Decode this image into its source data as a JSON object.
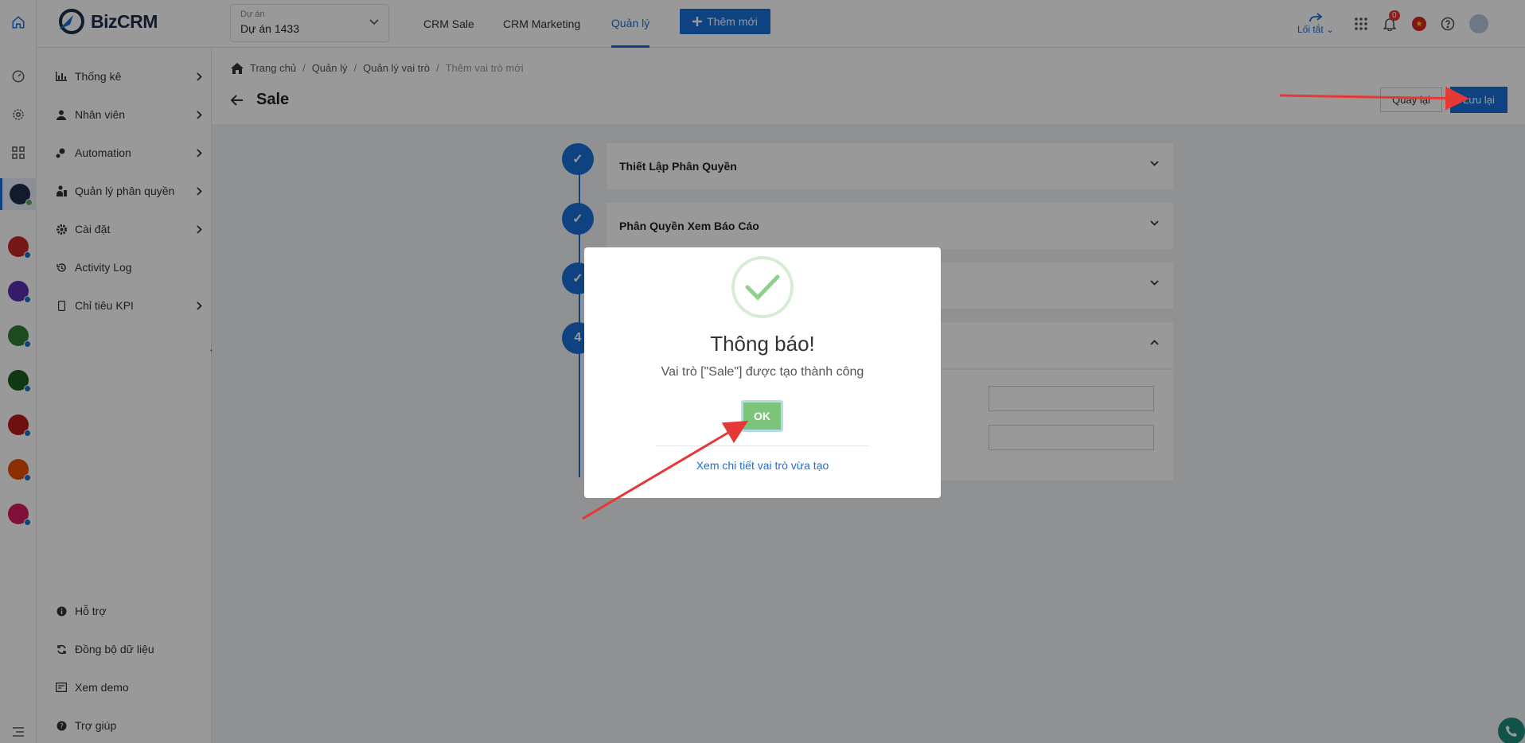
{
  "header": {
    "logo_text": "BizCRM",
    "project_label": "Dự án",
    "project_value": "Dự án 1433",
    "nav": [
      "CRM Sale",
      "CRM Marketing",
      "Quản lý"
    ],
    "add_button": "Thêm mới",
    "shortcut_label": "Lối tắt",
    "notification_count": "0"
  },
  "sidebar": {
    "items": [
      {
        "label": "Thống kê",
        "icon": "bar-chart-icon"
      },
      {
        "label": "Nhân viên",
        "icon": "user-icon"
      },
      {
        "label": "Automation",
        "icon": "automation-icon"
      },
      {
        "label": "Quản lý phân quyền",
        "icon": "permission-icon"
      },
      {
        "label": "Cài đặt",
        "icon": "gear-icon"
      },
      {
        "label": "Activity Log",
        "icon": "history-icon"
      },
      {
        "label": "Chỉ tiêu KPI",
        "icon": "mobile-icon"
      }
    ],
    "bottom": [
      {
        "label": "Hỗ trợ",
        "icon": "info-icon"
      },
      {
        "label": "Đồng bộ dữ liệu",
        "icon": "sync-icon"
      },
      {
        "label": "Xem demo",
        "icon": "demo-icon"
      },
      {
        "label": "Trợ giúp",
        "icon": "help-icon"
      }
    ]
  },
  "breadcrumb": [
    "Trang chủ",
    "Quản lý",
    "Quản lý vai trò",
    "Thêm vai trò mới"
  ],
  "page": {
    "title": "Sale",
    "back_button": "Quay lại",
    "save_button": "Lưu lại"
  },
  "steps": [
    {
      "marker": "✓",
      "title": "Thiết Lập Phân Quyền"
    },
    {
      "marker": "✓",
      "title": "Phân Quyền Xem Báo Cáo"
    },
    {
      "marker": "✓",
      "title": ""
    },
    {
      "marker": "4",
      "title": ""
    }
  ],
  "dialog": {
    "title": "Thông báo!",
    "message": "Vai trò [\"Sale\"] được tạo thành công",
    "ok": "OK",
    "link": "Xem chi tiết vai trò vừa tạo"
  },
  "colors": {
    "primary": "#1a6fd6",
    "success": "#7cc47a",
    "annotation": "#e53935"
  }
}
